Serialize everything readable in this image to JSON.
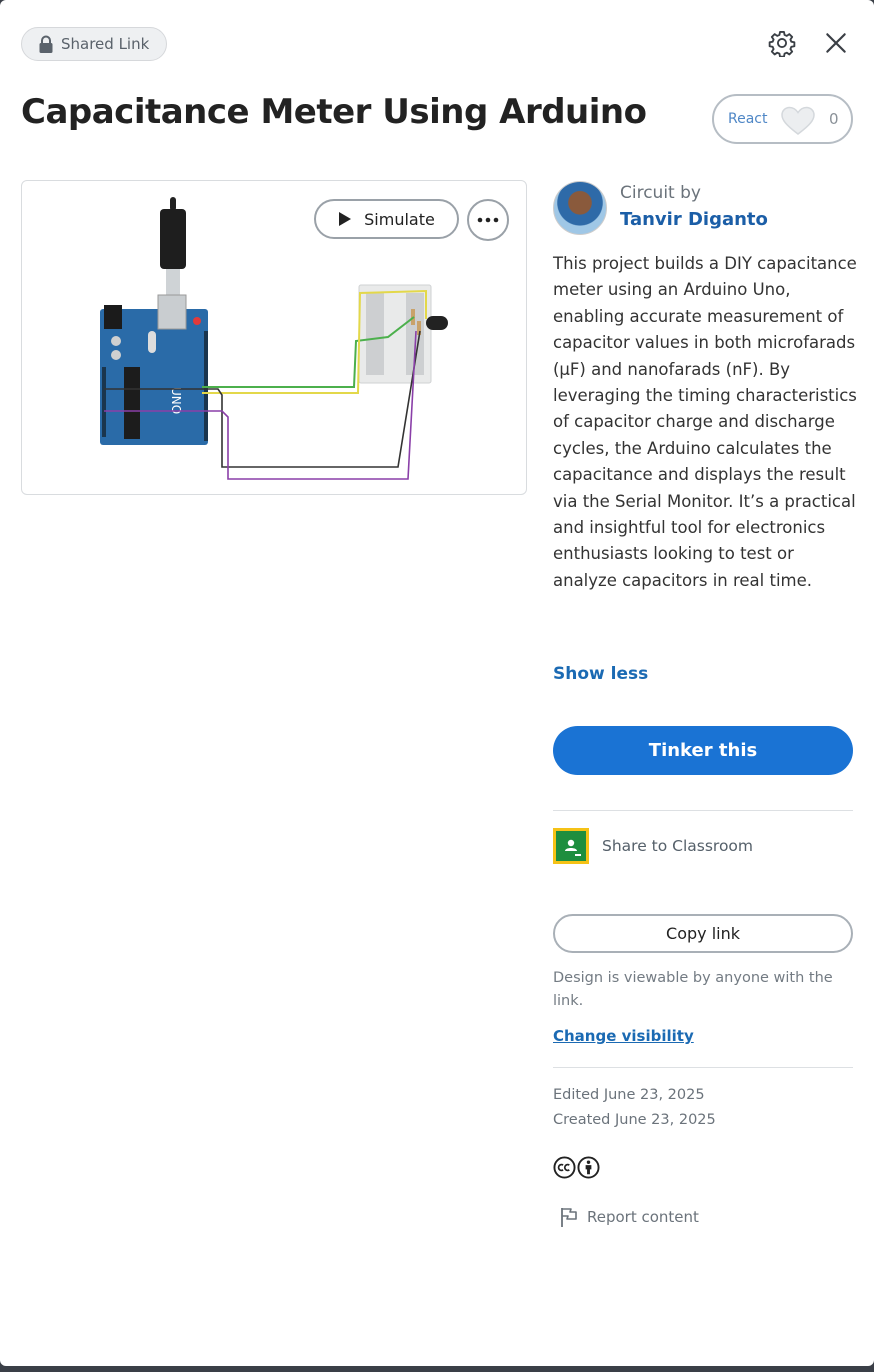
{
  "header": {
    "shared_label": "Shared Link",
    "title": "Capacitance Meter Using Arduino",
    "react_label": "React",
    "react_count": "0"
  },
  "preview": {
    "simulate_label": "Simulate"
  },
  "author": {
    "circuit_by": "Circuit by",
    "name": "Tanvir Diganto"
  },
  "description": "This project builds a DIY capacitance meter using an Arduino Uno, enabling accurate measurement of capacitor values in both microfarads (μF) and nanofarads (nF). By leveraging the timing characteristics of capacitor charge and discharge cycles, the Arduino calculates the capacitance and displays the result via the Serial Monitor. It’s a practical and insightful tool for electronics enthusiasts looking to test or analyze capacitors in real time.",
  "actions": {
    "show_less": "Show less",
    "tinker": "Tinker this",
    "classroom": "Share to Classroom",
    "copy_link": "Copy link",
    "viewable": "Design is viewable by anyone with the link.",
    "change_visibility": "Change visibility"
  },
  "meta": {
    "edited": "Edited June 23, 2025",
    "created": "Created June 23, 2025",
    "report": "Report content"
  },
  "colors": {
    "accent": "#1a73d4",
    "link": "#1b6ab3",
    "classroom_border": "#f5c216",
    "classroom_fill": "#1e8e3e"
  },
  "icons": [
    "lock-icon",
    "gear-icon",
    "close-icon",
    "heart-icon",
    "play-icon",
    "more-icon",
    "google-classroom-icon",
    "cc-icon",
    "attribution-icon",
    "flag-icon"
  ]
}
